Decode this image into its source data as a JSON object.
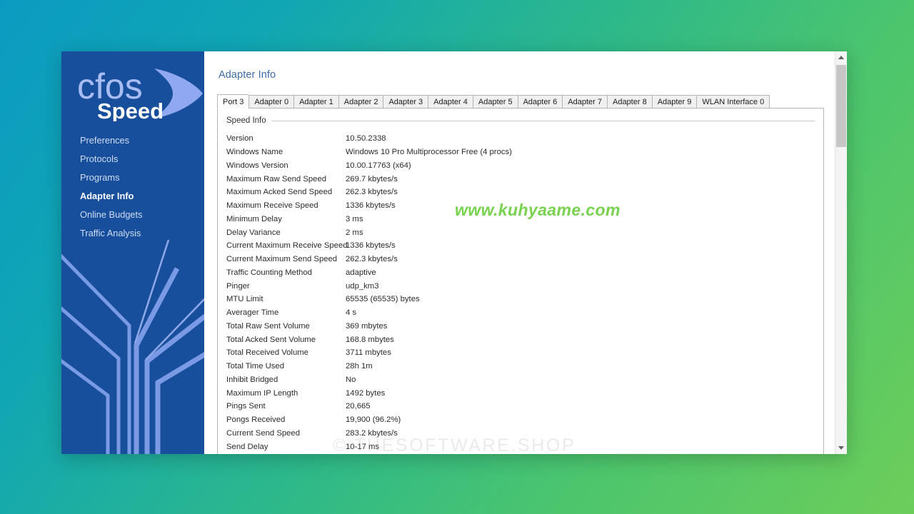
{
  "app": {
    "page_title": "Adapter Info",
    "brand_primary": "cfos",
    "brand_secondary": "Speed",
    "sidebar_bg": "#174f9c",
    "title_color": "#3d6ca6"
  },
  "sidebar": {
    "items": [
      {
        "label": "Preferences",
        "active": false
      },
      {
        "label": "Protocols",
        "active": false
      },
      {
        "label": "Programs",
        "active": false
      },
      {
        "label": "Adapter Info",
        "active": true
      },
      {
        "label": "Online Budgets",
        "active": false
      },
      {
        "label": "Traffic Analysis",
        "active": false
      }
    ]
  },
  "tabs": [
    {
      "label": "Port 3",
      "active": true
    },
    {
      "label": "Adapter 0",
      "active": false
    },
    {
      "label": "Adapter 1",
      "active": false
    },
    {
      "label": "Adapter 2",
      "active": false
    },
    {
      "label": "Adapter 3",
      "active": false
    },
    {
      "label": "Adapter 4",
      "active": false
    },
    {
      "label": "Adapter 5",
      "active": false
    },
    {
      "label": "Adapter 6",
      "active": false
    },
    {
      "label": "Adapter 7",
      "active": false
    },
    {
      "label": "Adapter 8",
      "active": false
    },
    {
      "label": "Adapter 9",
      "active": false
    },
    {
      "label": "WLAN Interface 0",
      "active": false
    }
  ],
  "speed_info": {
    "group_label": "Speed Info",
    "rows": [
      {
        "key": "Version",
        "value": "10.50.2338"
      },
      {
        "key": "Windows Name",
        "value": "Windows 10 Pro Multiprocessor Free (4 procs)"
      },
      {
        "key": "Windows Version",
        "value": "10.00.17763 (x64)"
      },
      {
        "key": "Maximum Raw Send Speed",
        "value": "269.7 kbytes/s"
      },
      {
        "key": "Maximum Acked Send Speed",
        "value": "262.3 kbytes/s"
      },
      {
        "key": "Maximum Receive Speed",
        "value": "1336 kbytes/s"
      },
      {
        "key": "Minimum Delay",
        "value": "3 ms"
      },
      {
        "key": "Delay Variance",
        "value": "2 ms"
      },
      {
        "key": "Current Maximum Receive Speed",
        "value": "1336 kbytes/s"
      },
      {
        "key": "Current Maximum Send Speed",
        "value": "262.3 kbytes/s"
      },
      {
        "key": "Traffic Counting Method",
        "value": "adaptive"
      },
      {
        "key": "Pinger",
        "value": "udp_km3"
      },
      {
        "key": "MTU Limit",
        "value": "65535 (65535) bytes"
      },
      {
        "key": "Averager Time",
        "value": "4 s"
      },
      {
        "key": "Total Raw Sent Volume",
        "value": "369 mbytes"
      },
      {
        "key": "Total Acked Sent Volume",
        "value": "168.8 mbytes"
      },
      {
        "key": "Total Received Volume",
        "value": "3711 mbytes"
      },
      {
        "key": "Total Time Used",
        "value": "28h 1m"
      },
      {
        "key": "Inhibit Bridged",
        "value": "No"
      },
      {
        "key": "Maximum IP Length",
        "value": "1492 bytes"
      },
      {
        "key": "Pings Sent",
        "value": "20,665"
      },
      {
        "key": "Pongs Received",
        "value": "19,900 (96.2%)"
      },
      {
        "key": "Current Send Speed",
        "value": "283.2 kbytes/s"
      },
      {
        "key": "Send Delay",
        "value": "10-17 ms"
      }
    ]
  },
  "scrollbar": {
    "up_arrow": "▲",
    "down_arrow": "▼"
  },
  "watermarks": {
    "site": "www.kuhyaame.com",
    "site_color": "#79d24f",
    "shop": "© THESOFTWARE.SHOP"
  }
}
